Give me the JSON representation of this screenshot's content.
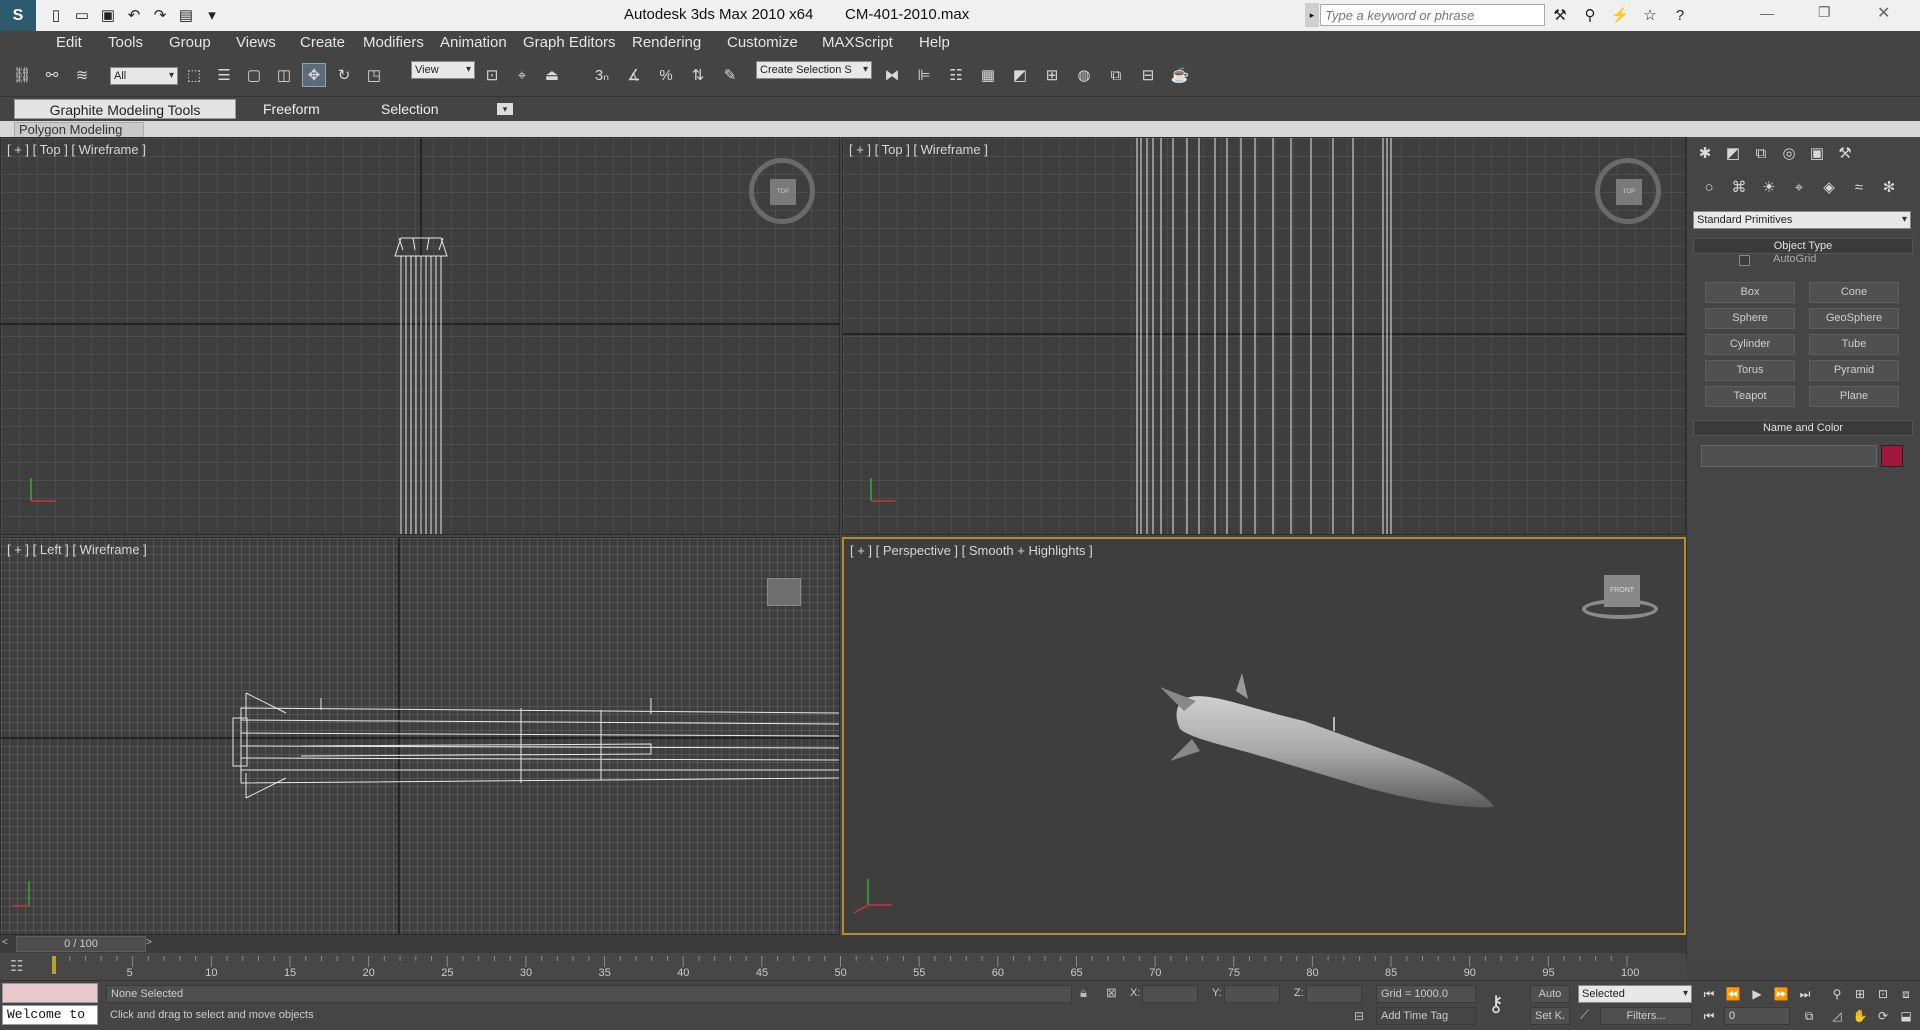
{
  "window": {
    "app_title": "Autodesk 3ds Max  2010 x64",
    "file_name": "CM-401-2010.max",
    "search_placeholder": "Type a keyword or phrase"
  },
  "menu": [
    "Edit",
    "Tools",
    "Group",
    "Views",
    "Create",
    "Modifiers",
    "Animation",
    "Graph Editors",
    "Rendering",
    "Customize",
    "MAXScript",
    "Help"
  ],
  "toolbar": {
    "selection_filter": "All",
    "ref_coord": "View",
    "snap_label": "3",
    "named_selection": "Create Selection S"
  },
  "ribbon": {
    "tabs": [
      "Graphite Modeling Tools",
      "Freeform",
      "Selection"
    ],
    "subtab": "Polygon Modeling"
  },
  "viewports": [
    {
      "label": "[ + ] [ Top ] [ Wireframe ]",
      "active": false
    },
    {
      "label": "[ + ] [ Top ] [ Wireframe ]",
      "active": false
    },
    {
      "label": "[ + ] [ Left ] [ Wireframe ]",
      "active": false
    },
    {
      "label": "[ + ] [ Perspective ] [ Smooth + Highlights ]",
      "active": true
    }
  ],
  "viewcube": {
    "top_label": "TOP",
    "front_label": "FRONT"
  },
  "command_panel": {
    "category": "Standard Primitives",
    "object_type_title": "Object Type",
    "autogrid": "AutoGrid",
    "buttons": [
      "Box",
      "Cone",
      "Sphere",
      "GeoSphere",
      "Cylinder",
      "Tube",
      "Torus",
      "Pyramid",
      "Teapot",
      "Plane"
    ],
    "name_color_title": "Name and Color",
    "object_color": "#a0173b"
  },
  "timeline": {
    "frame_display": "0 / 100",
    "ticks": [
      "5",
      "10",
      "15",
      "20",
      "25",
      "30",
      "35",
      "40",
      "45",
      "50",
      "55",
      "60",
      "65",
      "70",
      "75",
      "80",
      "85",
      "90",
      "95",
      "100"
    ]
  },
  "status": {
    "maxscript_text": "Welcome to",
    "selection_status": "None Selected",
    "prompt": "Click and drag to select and move objects",
    "x_label": "X:",
    "y_label": "Y:",
    "z_label": "Z:",
    "grid": "Grid = 1000.0",
    "add_time_tag": "Add Time Tag",
    "auto_key": "Auto",
    "set_key": "Set K.",
    "key_filter": "Selected",
    "filters": "Filters...",
    "current_frame": "0"
  }
}
